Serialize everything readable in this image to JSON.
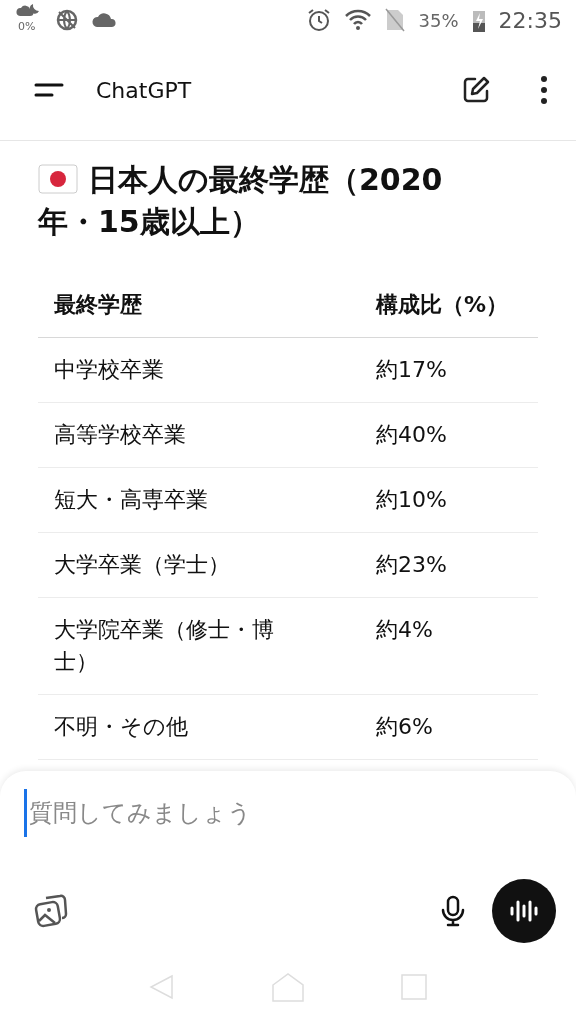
{
  "status_bar": {
    "weather_reading": "0%",
    "battery": "35%",
    "time": "22:35"
  },
  "header": {
    "title": "ChatGPT"
  },
  "heading": "日本人の最終学歴（2020年・15歳以上）",
  "table": {
    "columns": [
      "最終学歴",
      "構成比（%）"
    ],
    "rows": [
      [
        "中学校卒業",
        "約17%"
      ],
      [
        "高等学校卒業",
        "約40%"
      ],
      [
        "短大・高専卒業",
        "約10%"
      ],
      [
        "大学卒業（学士）",
        "約23%"
      ],
      [
        "大学院卒業（修士・博士）",
        "約4%"
      ],
      [
        "不明・その他",
        "約6%"
      ]
    ]
  },
  "composer": {
    "placeholder": "質問してみましょう"
  }
}
